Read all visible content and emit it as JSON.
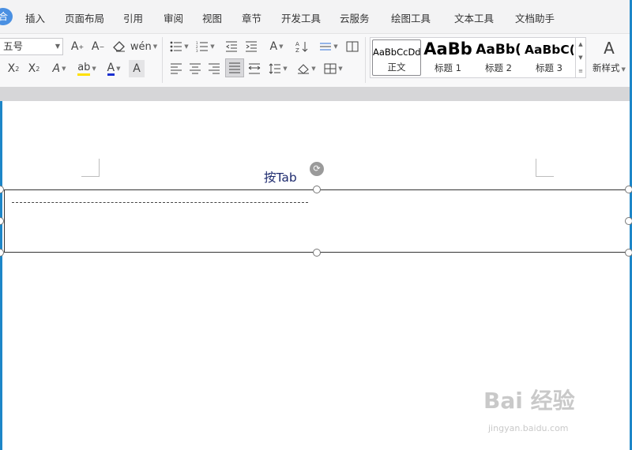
{
  "menu": {
    "logo": "合",
    "items": [
      "插入",
      "页面布局",
      "引用",
      "审阅",
      "视图",
      "章节",
      "开发工具",
      "云服务",
      "绘图工具",
      "文本工具",
      "文档助手"
    ]
  },
  "toolbar": {
    "font_size_value": "五号",
    "styles": [
      {
        "sample": "AaBbCcDd",
        "caption": "正文"
      },
      {
        "sample": "AaBb",
        "caption": "标题 1"
      },
      {
        "sample": "AaBb(",
        "caption": "标题 2"
      },
      {
        "sample": "AaBbC(",
        "caption": "标题 3"
      }
    ],
    "new_style_label": "新样式"
  },
  "document": {
    "header_text": "按Tab"
  },
  "watermark": {
    "main": "Bai 经验",
    "sub": "jingyan.baidu.com"
  },
  "colors": {
    "accent": "#1d86c8",
    "header_text": "#1f2c6f",
    "highlight": "#ffe100",
    "font_color": "#1a2fd0"
  }
}
